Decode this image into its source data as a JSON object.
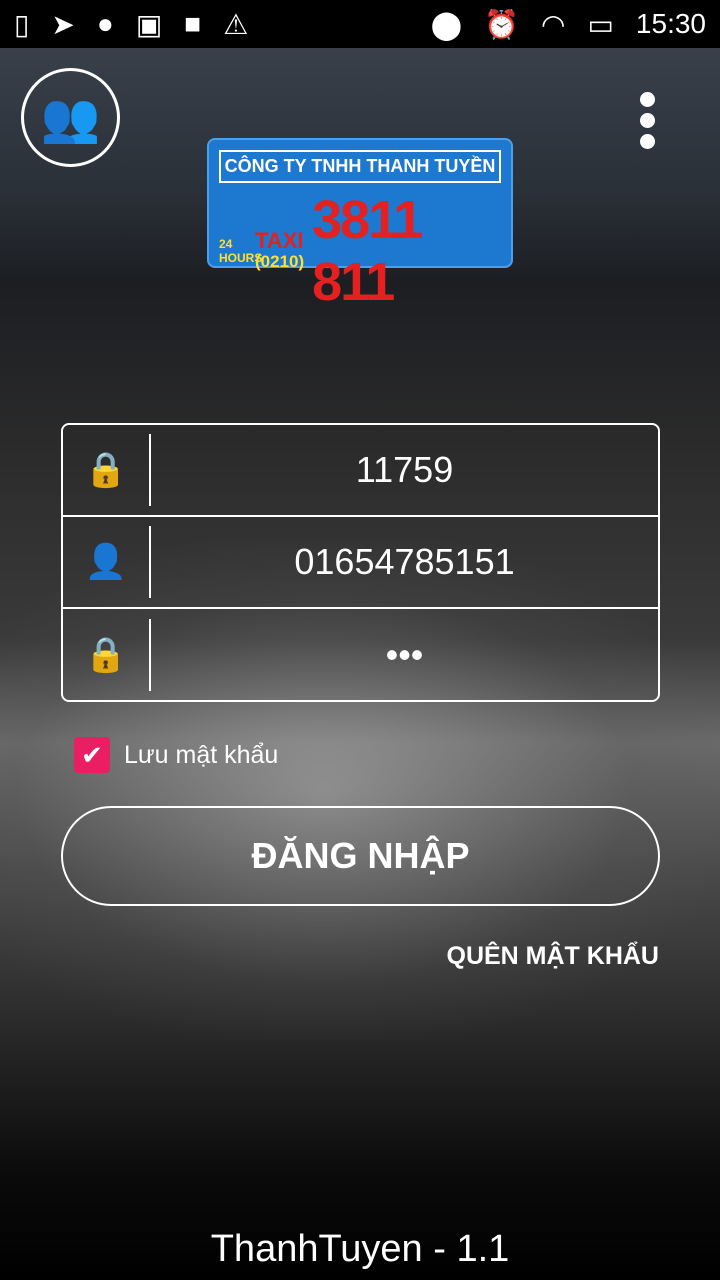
{
  "status_bar": {
    "time": "15:30",
    "icons": [
      "sim-alert-icon",
      "send-icon",
      "circle-icon",
      "image-icon",
      "square-icon",
      "warning-icon",
      "location-icon",
      "alarm-icon",
      "wifi-icon",
      "battery-charging-icon"
    ]
  },
  "logo": {
    "company": "CÔNG TY TNHH THANH TUYỀN",
    "taxi": "TAXI",
    "area_code": "(0210)",
    "phone": "3811 811",
    "hours": "24 HOURS"
  },
  "form": {
    "code": "11759",
    "phone": "01654785151",
    "password": "•••"
  },
  "remember": {
    "label": "Lưu mật khẩu",
    "checked": true
  },
  "login_button": "ĐĂNG NHẬP",
  "forgot_link": "QUÊN MẬT KHẨU",
  "version": "ThanhTuyen - 1.1",
  "colors": {
    "accent": "#e91e63",
    "logo_bg": "#1d78d0"
  }
}
